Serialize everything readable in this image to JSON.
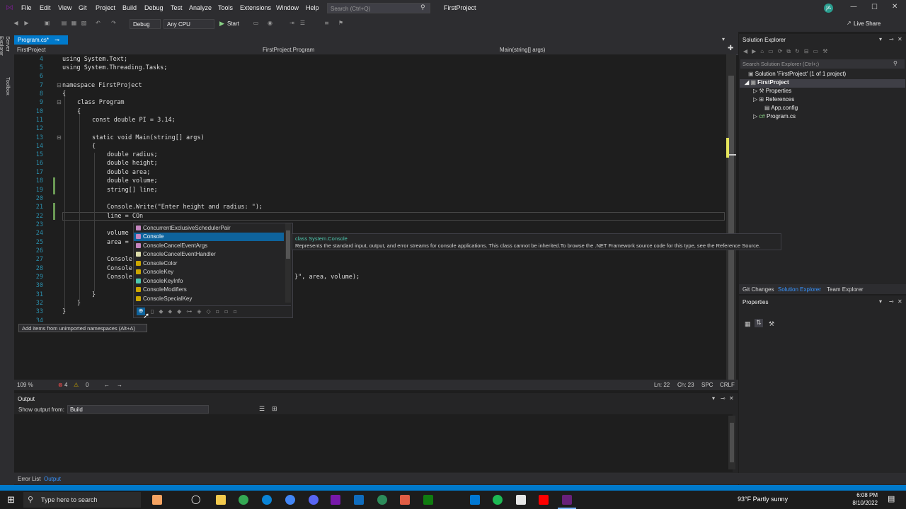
{
  "menubar": {
    "items": [
      "File",
      "Edit",
      "View",
      "Git",
      "Project",
      "Build",
      "Debug",
      "Test",
      "Analyze",
      "Tools",
      "Extensions",
      "Window",
      "Help"
    ],
    "search_placeholder": "Search (Ctrl+Q)",
    "solution_name": "FirstProject",
    "user_initials": "JA",
    "live_share": "Live Share"
  },
  "toolbar": {
    "config": "Debug",
    "platform": "Any CPU",
    "start": "Start"
  },
  "sidestrip": {
    "server_explorer": "Server Explorer",
    "toolbox": "Toolbox"
  },
  "editor": {
    "tab_label": "Program.cs*",
    "nav_project": "FirstProject",
    "nav_class": "FirstProject.Program",
    "nav_member": "Main(string[] args)",
    "zoom": "109 %",
    "errors": "4",
    "warnings": "0",
    "position_line": "Ln: 22",
    "position_col": "Ch: 23",
    "spc": "SPC",
    "crlf": "CRLF"
  },
  "code_lines": [
    {
      "n": "4",
      "t": "using System.Text;"
    },
    {
      "n": "5",
      "t": "using System.Threading.Tasks;"
    },
    {
      "n": "6",
      "t": ""
    },
    {
      "n": "7",
      "t": "namespace FirstProject"
    },
    {
      "n": "8",
      "t": "{"
    },
    {
      "n": "9",
      "t": "class Program"
    },
    {
      "n": "10",
      "t": "{"
    },
    {
      "n": "11",
      "t": "const double PI = 3.14;"
    },
    {
      "n": "12",
      "t": ""
    },
    {
      "n": "13",
      "t": "static void Main(string[] args)"
    },
    {
      "n": "14",
      "t": "{"
    },
    {
      "n": "15",
      "t": "double radius;"
    },
    {
      "n": "16",
      "t": "double height;"
    },
    {
      "n": "17",
      "t": "double area;"
    },
    {
      "n": "18",
      "t": "double volume;"
    },
    {
      "n": "19",
      "t": "string[] line;"
    },
    {
      "n": "20",
      "t": ""
    },
    {
      "n": "21",
      "t": "Console.Write(\"Enter height and radius: \");"
    },
    {
      "n": "22",
      "t": "line = COn"
    },
    {
      "n": "23",
      "t": ""
    },
    {
      "n": "24",
      "t": "volume"
    },
    {
      "n": "25",
      "t": "area ="
    },
    {
      "n": "26",
      "t": ""
    },
    {
      "n": "27",
      "t": "Console"
    },
    {
      "n": "28",
      "t": "Console"
    },
    {
      "n": "29",
      "t": "Console"
    },
    {
      "n": "30",
      "t": ""
    },
    {
      "n": "31",
      "t": "}"
    },
    {
      "n": "32",
      "t": "}"
    },
    {
      "n": "33",
      "t": "}"
    },
    {
      "n": "34",
      "t": ""
    }
  ],
  "line29_tail": "}\", area, volume);",
  "intellisense": {
    "items": [
      "ConcurrentExclusiveSchedulerPair",
      "Console",
      "ConsoleCancelEventArgs",
      "ConsoleCancelEventHandler",
      "ConsoleColor",
      "ConsoleKey",
      "ConsoleKeyInfo",
      "ConsoleModifiers",
      "ConsoleSpecialKey"
    ],
    "selected_index": 1,
    "tooltip_kind": "class System.Console",
    "tooltip_desc": "Represents the standard input, output, and error streams for console applications. This class cannot be inherited.To browse the .NET Framework source code for this type, see the Reference Source.",
    "unimported_hint": "Add items from unimported namespaces (Alt+A)"
  },
  "solution_explorer": {
    "title": "Solution Explorer",
    "search_placeholder": "Search Solution Explorer (Ctrl+;)",
    "solution": "Solution 'FirstProject' (1 of 1 project)",
    "project": "FirstProject",
    "nodes": [
      "Properties",
      "References",
      "App.config",
      "Program.cs"
    ],
    "tabs": [
      "Git Changes",
      "Solution Explorer",
      "Team Explorer"
    ]
  },
  "properties": {
    "title": "Properties"
  },
  "output": {
    "title": "Output",
    "show_from_label": "Show output from:",
    "source": "Build"
  },
  "bottom_tabs": [
    "Error List",
    "Output"
  ],
  "taskbar": {
    "search_placeholder": "Type here to search",
    "weather": "93°F  Partly sunny",
    "time": "6:08 PM",
    "date": "8/10/2022"
  },
  "colors": {
    "accent": "#007acc",
    "selection": "#062f4a",
    "popup_selected": "#0e639c"
  }
}
